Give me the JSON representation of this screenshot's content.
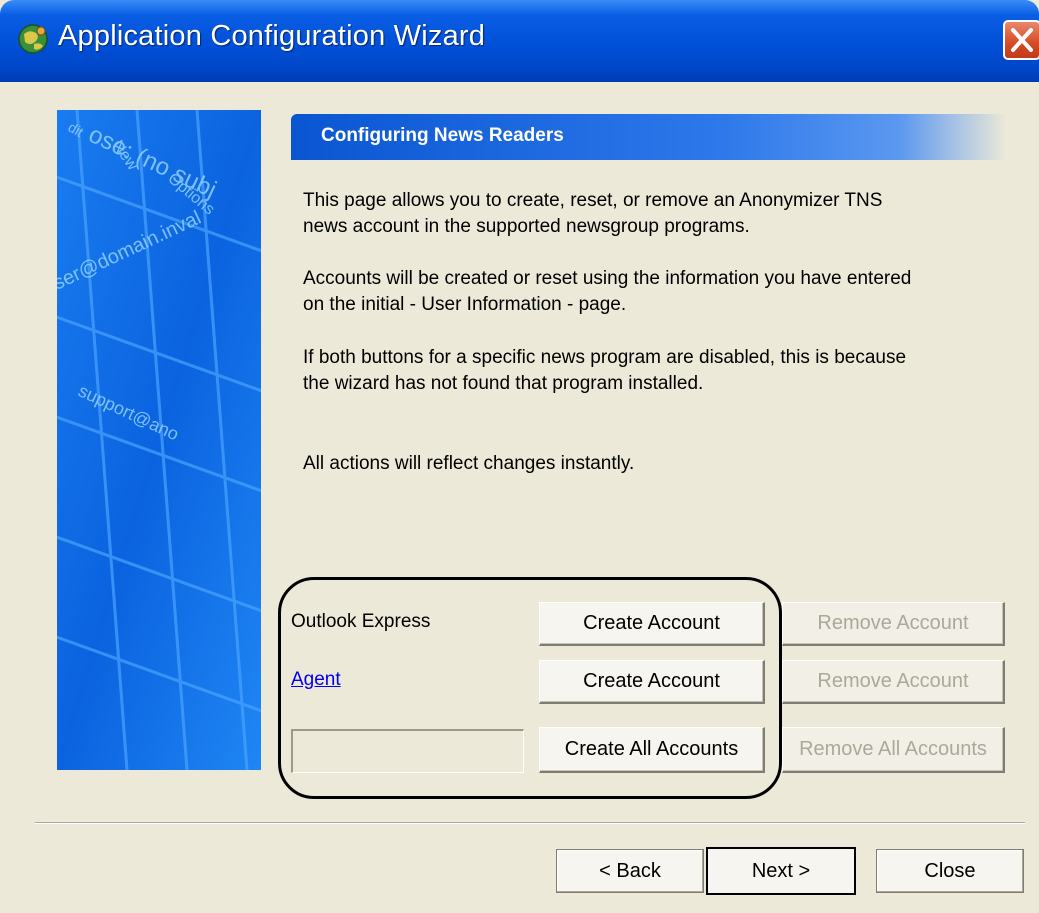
{
  "window": {
    "title": "Application Configuration Wizard"
  },
  "header": {
    "title": "Configuring News Readers"
  },
  "content": {
    "paragraph_1": "This page allows you to create, reset, or remove an Anonymizer TNS\nnews account in the supported newsgroup programs.",
    "paragraph_2": "Accounts will be created or reset using the information you have entered\non the initial - User Information - page.",
    "paragraph_3": "If both buttons for a specific news program are disabled, this is because\nthe wizard has not found that program installed.",
    "paragraph_4": "All actions will reflect changes instantly."
  },
  "programs": [
    {
      "label": "Outlook Express",
      "create_label": "Create Account",
      "remove_label": "Remove Account",
      "remove_enabled": false
    },
    {
      "label": "Agent",
      "create_label": "Create Account",
      "remove_label": "Remove Account",
      "remove_enabled": false,
      "is_link": true
    }
  ],
  "bulk": {
    "create_all_label": "Create All Accounts",
    "remove_all_label": "Remove All Accounts",
    "status_field_value": ""
  },
  "side_image_text": {
    "line_1": "ose: (no subj",
    "line_2": "ser@domain.inval",
    "line_3": "support@ano",
    "line_4": "Options",
    "line_5": "New",
    "line_6": "dit"
  },
  "footer": {
    "back_label": "< Back",
    "next_label": "Next >",
    "close_label": "Close"
  },
  "colors": {
    "titlebar": "#0050d8",
    "header_band": "#0a56d2",
    "dialog_bg": "#ece9d8",
    "close_button": "#d54a26",
    "disabled_text": "#aca899",
    "link": "#0000ee"
  }
}
